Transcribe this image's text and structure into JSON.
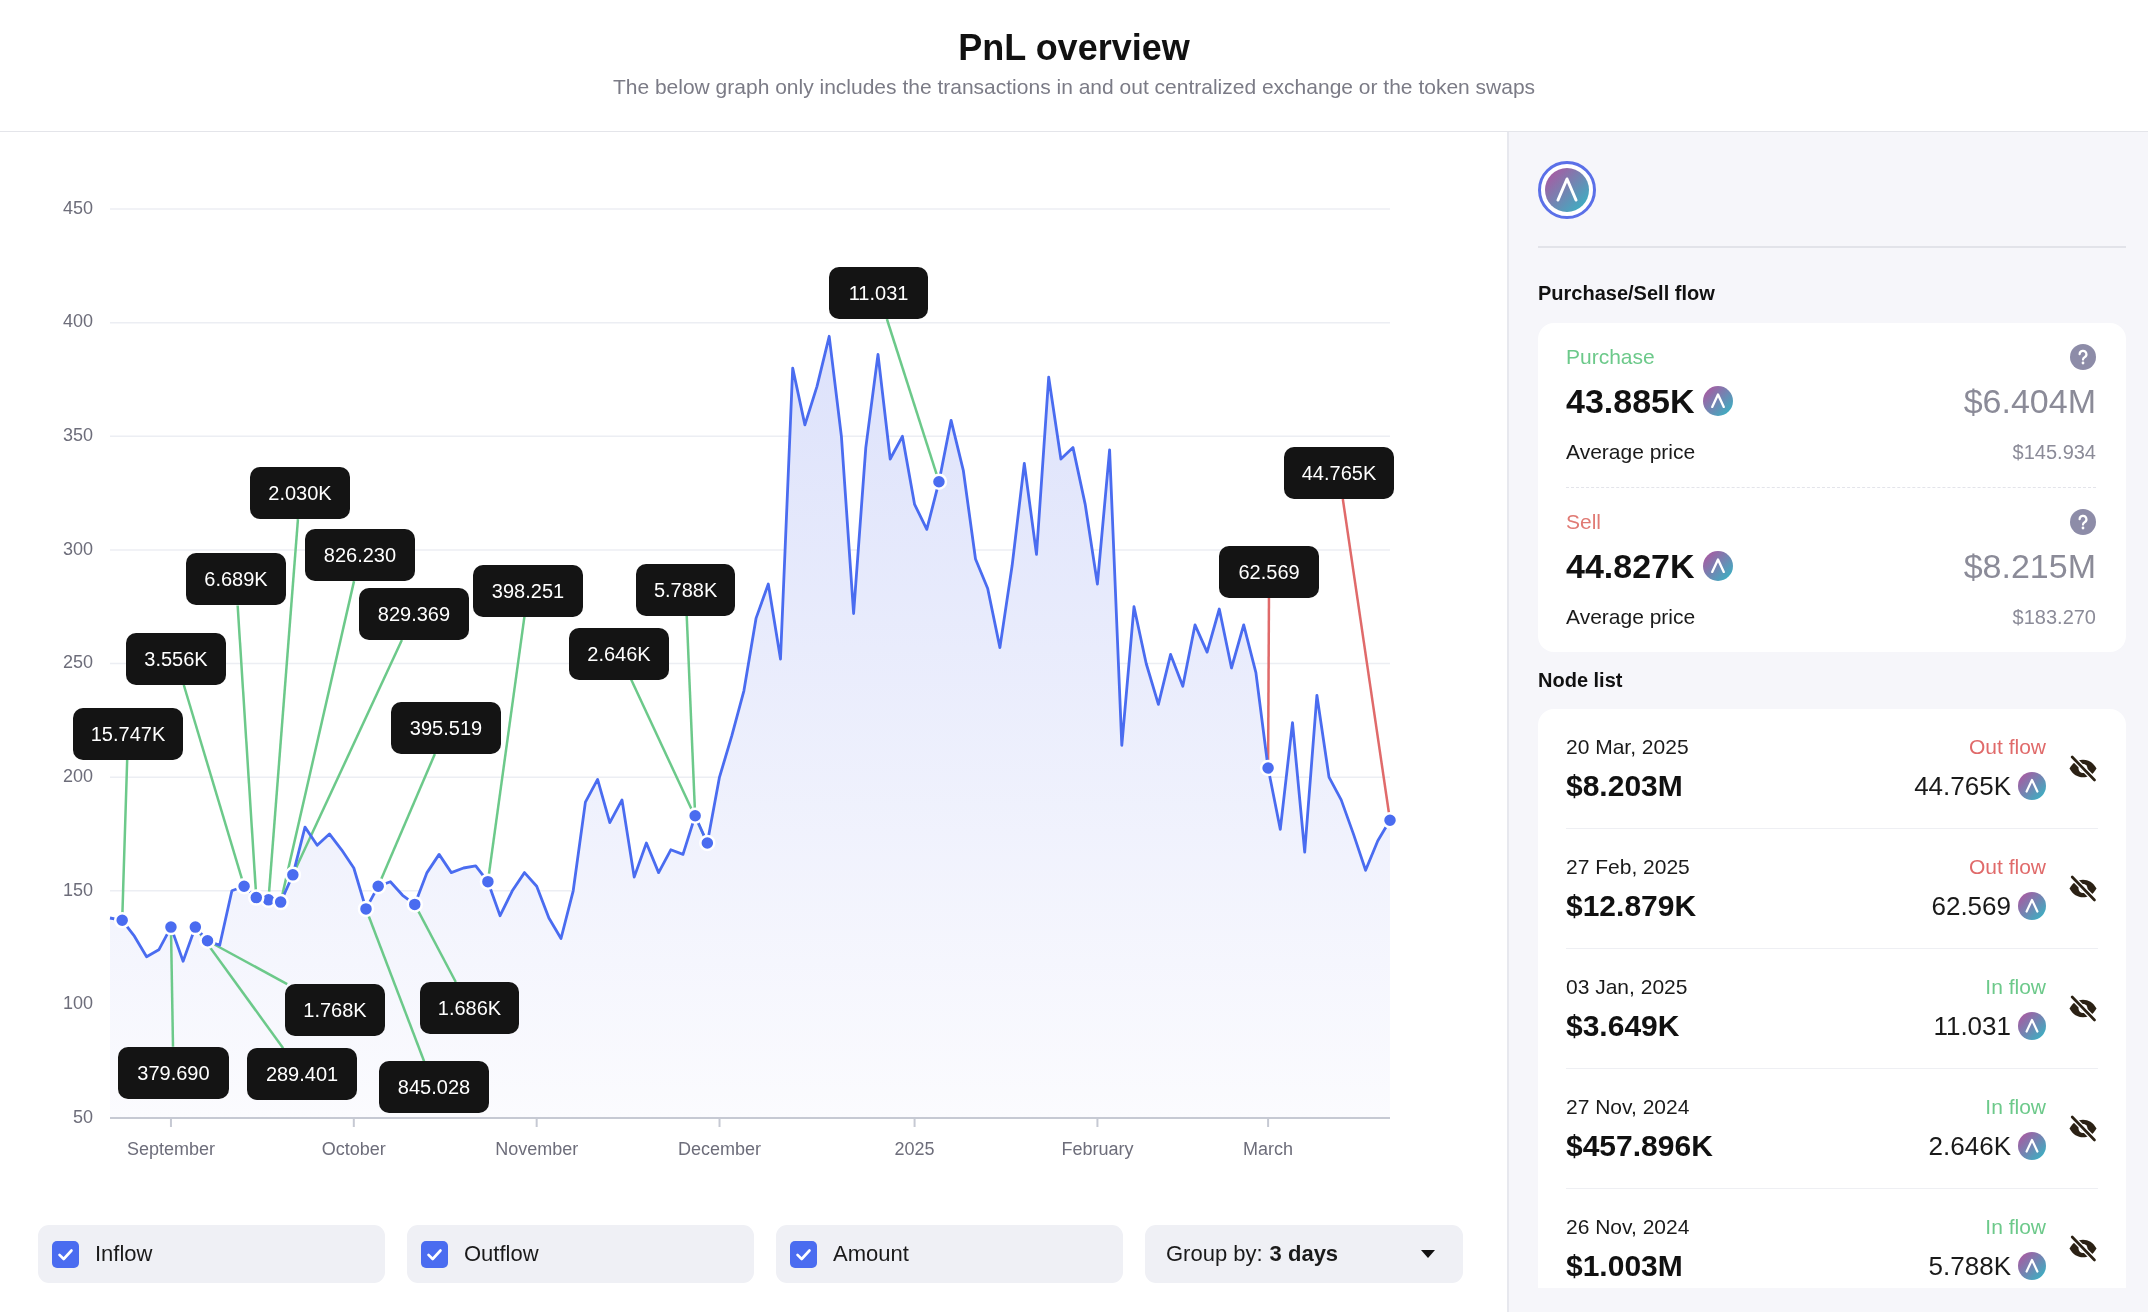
{
  "header": {
    "title": "PnL overview",
    "subtitle": "The below graph only includes the transactions in and out centralized exchange or the token swaps"
  },
  "chart": {
    "chart_data": {
      "type": "area",
      "grid": true,
      "ylim": [
        50,
        450
      ],
      "yticks": [
        50,
        100,
        150,
        200,
        250,
        300,
        350,
        400,
        450
      ],
      "categories": [
        null,
        null,
        null,
        null,
        null,
        "September",
        null,
        null,
        null,
        null,
        null,
        null,
        null,
        null,
        null,
        null,
        null,
        null,
        null,
        null,
        "October",
        null,
        null,
        null,
        null,
        null,
        null,
        null,
        null,
        null,
        null,
        null,
        null,
        null,
        null,
        "November",
        null,
        null,
        null,
        null,
        null,
        null,
        null,
        null,
        null,
        null,
        null,
        null,
        null,
        null,
        "December",
        null,
        null,
        null,
        null,
        null,
        null,
        null,
        null,
        null,
        null,
        null,
        null,
        null,
        null,
        null,
        "2025",
        null,
        null,
        null,
        null,
        null,
        null,
        null,
        null,
        null,
        null,
        null,
        null,
        null,
        null,
        "February",
        null,
        null,
        null,
        null,
        null,
        null,
        null,
        null,
        null,
        null,
        null,
        null,
        null,
        "March",
        null,
        null,
        null,
        null,
        null,
        null,
        null,
        null,
        null,
        null
      ],
      "values": [
        138,
        137,
        130,
        121,
        124,
        134,
        119,
        134,
        128,
        126,
        150,
        152,
        147,
        146,
        145,
        157,
        178,
        170,
        175,
        168,
        160,
        142,
        152,
        154,
        148,
        144,
        158,
        166,
        158,
        160,
        161,
        154,
        139,
        150,
        158,
        152,
        138,
        129,
        150,
        189,
        199,
        180,
        190,
        156,
        171,
        158,
        168,
        166,
        183,
        171,
        200,
        218,
        238,
        270,
        285,
        252,
        380,
        355,
        372,
        394,
        350,
        272,
        345,
        386,
        340,
        350,
        320,
        309,
        330,
        357,
        335,
        296,
        283,
        257,
        293,
        338,
        298,
        376,
        340,
        345,
        320,
        285,
        344,
        214,
        275,
        250,
        232,
        254,
        240,
        267,
        255,
        274,
        248,
        267,
        246,
        204,
        177,
        224,
        167,
        236,
        200,
        190,
        175,
        159,
        172,
        181
      ]
    },
    "markers": [
      {
        "text": "11.031",
        "kind": "inflow"
      },
      {
        "text": "44.765K",
        "kind": "outflow"
      },
      {
        "text": "2.030K",
        "kind": "inflow"
      },
      {
        "text": "826.230",
        "kind": "inflow"
      },
      {
        "text": "62.569",
        "kind": "outflow"
      },
      {
        "text": "6.689K",
        "kind": "inflow"
      },
      {
        "text": "398.251",
        "kind": "inflow"
      },
      {
        "text": "5.788K",
        "kind": "inflow"
      },
      {
        "text": "829.369",
        "kind": "inflow"
      },
      {
        "text": "2.646K",
        "kind": "inflow"
      },
      {
        "text": "3.556K",
        "kind": "inflow"
      },
      {
        "text": "395.519",
        "kind": "inflow"
      },
      {
        "text": "15.747K",
        "kind": "inflow"
      },
      {
        "text": "1.768K",
        "kind": "inflow"
      },
      {
        "text": "1.686K",
        "kind": "inflow"
      },
      {
        "text": "379.690",
        "kind": "inflow"
      },
      {
        "text": "289.401",
        "kind": "inflow"
      },
      {
        "text": "845.028",
        "kind": "inflow"
      }
    ]
  },
  "filters": [
    {
      "label": "Inflow",
      "checked": true
    },
    {
      "label": "Outflow",
      "checked": true
    },
    {
      "label": "Amount",
      "checked": true
    }
  ],
  "group_by": {
    "label": "Group by:",
    "value": "3 days"
  },
  "side_panel": {
    "flow_title": "Purchase/Sell flow",
    "flows": [
      {
        "kind": "purchase",
        "label": "Purchase",
        "amount": "43.885K",
        "usd": "$6.404M",
        "avg_label": "Average price",
        "avg_price": "$145.934"
      },
      {
        "kind": "sell",
        "label": "Sell",
        "amount": "44.827K",
        "usd": "$8.215M",
        "avg_label": "Average price",
        "avg_price": "$183.270"
      }
    ],
    "node_title": "Node list",
    "nodes": [
      {
        "date": "20 Mar, 2025",
        "usd": "$8.203M",
        "flow": "Out flow",
        "kind": "outflow",
        "amount": "44.765K"
      },
      {
        "date": "27 Feb, 2025",
        "usd": "$12.879K",
        "flow": "Out flow",
        "kind": "outflow",
        "amount": "62.569"
      },
      {
        "date": "03 Jan, 2025",
        "usd": "$3.649K",
        "flow": "In flow",
        "kind": "inflow",
        "amount": "11.031"
      },
      {
        "date": "27 Nov, 2024",
        "usd": "$457.896K",
        "flow": "In flow",
        "kind": "inflow",
        "amount": "2.646K"
      },
      {
        "date": "26 Nov, 2024",
        "usd": "$1.003M",
        "flow": "In flow",
        "kind": "inflow",
        "amount": "5.788K"
      }
    ]
  }
}
